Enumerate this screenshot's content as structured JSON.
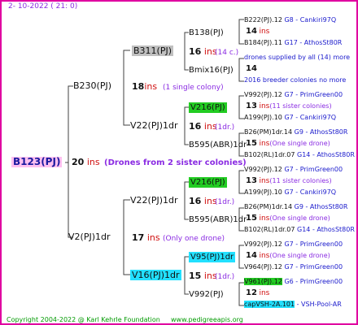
{
  "date": "2- 10-2022 (  21:  0)",
  "root": {
    "name": "B123(PJ)",
    "num": "20",
    "ins": "ins",
    "comment": "(Drones from 2 sister colonies)"
  },
  "g1": [
    {
      "name": "B230(PJ)",
      "num": "18",
      "ins": "ins",
      "comment": "(1 single colony)"
    },
    {
      "name": "V2(PJ)1dr",
      "num": "17",
      "ins": "ins",
      "comment": "(Only one drone)"
    }
  ],
  "g2": [
    {
      "name": "B311(PJ)",
      "num": "16",
      "ins": "ins",
      "comment": "(14 c.)"
    },
    {
      "name": "V22(PJ)1dr",
      "num": "16",
      "ins": "ins",
      "comment": "(1dr.)"
    },
    {
      "name": "V22(PJ)1dr",
      "num": "16",
      "ins": "ins",
      "comment": "(1dr.)"
    },
    {
      "name": "V16(PJ)1dr",
      "num": "15",
      "ins": "ins",
      "comment": "(1dr.)"
    }
  ],
  "g3": [
    {
      "name": "B138(PJ)"
    },
    {
      "name": "Bmix16(PJ)"
    },
    {
      "name": "V216(PJ)"
    },
    {
      "name": "B595(ABR)1dr"
    },
    {
      "name": "V216(PJ)"
    },
    {
      "name": "B595(ABR)1dr"
    },
    {
      "name": "V95(PJ)1dr"
    },
    {
      "name": "V992(PJ)"
    }
  ],
  "g4": [
    {
      "top": "B222(PJ).12",
      "topRc": "G8 - Cankiri97Q",
      "mid_num": "14",
      "mid_ins": "ins",
      "mid_cm": "",
      "bot": "B184(PJ).11",
      "botRc": "G17 - AthosSt80R"
    },
    {
      "top": "drones supplied by all (14) more",
      "topRc": "",
      "mid_num": "14",
      "mid_ins": "",
      "mid_cm": "",
      "bot": "2016 breeder colonies no more",
      "botRc": ""
    },
    {
      "top": "V992(PJ).12",
      "topRc": "G7 - PrimGreen00",
      "mid_num": "13",
      "mid_ins": "ins",
      "mid_cm": "(11 sister colonies)",
      "bot": "A199(PJ).10",
      "botRc": "G7 - Cankiri97Q"
    },
    {
      "top": "B26(PM)1dr.14",
      "topRc": "G9 - AthosSt80R",
      "mid_num": "15",
      "mid_ins": "ins",
      "mid_cm": "(One single drone)",
      "bot": "B102(RL)1dr.07",
      "botRc": "G14 - AthosSt80R"
    },
    {
      "top": "V992(PJ).12",
      "topRc": "G7 - PrimGreen00",
      "mid_num": "13",
      "mid_ins": "ins",
      "mid_cm": "(11 sister colonies)",
      "bot": "A199(PJ).10",
      "botRc": "G7 - Cankiri97Q"
    },
    {
      "top": "B26(PM)1dr.14",
      "topRc": "G9 - AthosSt80R",
      "mid_num": "15",
      "mid_ins": "ins",
      "mid_cm": "(One single drone)",
      "bot": "B102(RL)1dr.07",
      "botRc": "G14 - AthosSt80R"
    },
    {
      "top": "V992(PJ).12",
      "topRc": "G7 - PrimGreen00",
      "mid_num": "14",
      "mid_ins": "ins",
      "mid_cm": "(One single drone)",
      "bot": "V964(PJ).12",
      "botRc": "G7 - PrimGreen00"
    },
    {
      "top": "V961(PJ).12",
      "topRc": "G6 - PrimGreen00",
      "mid_num": "12",
      "mid_ins": "ins",
      "mid_cm": "",
      "bot": "capVSH-2A.101",
      "botRc": "- VSH-Pool-AR"
    }
  ],
  "footer": {
    "copyright": "Copyright 2004-2022 @ Karl Kehrle Foundation",
    "url": "www.pedigreeapis.org"
  },
  "colors": {
    "frame": "#e000a0",
    "ins": "#d01010",
    "comment": "#8a2be2",
    "line": "#404040"
  }
}
